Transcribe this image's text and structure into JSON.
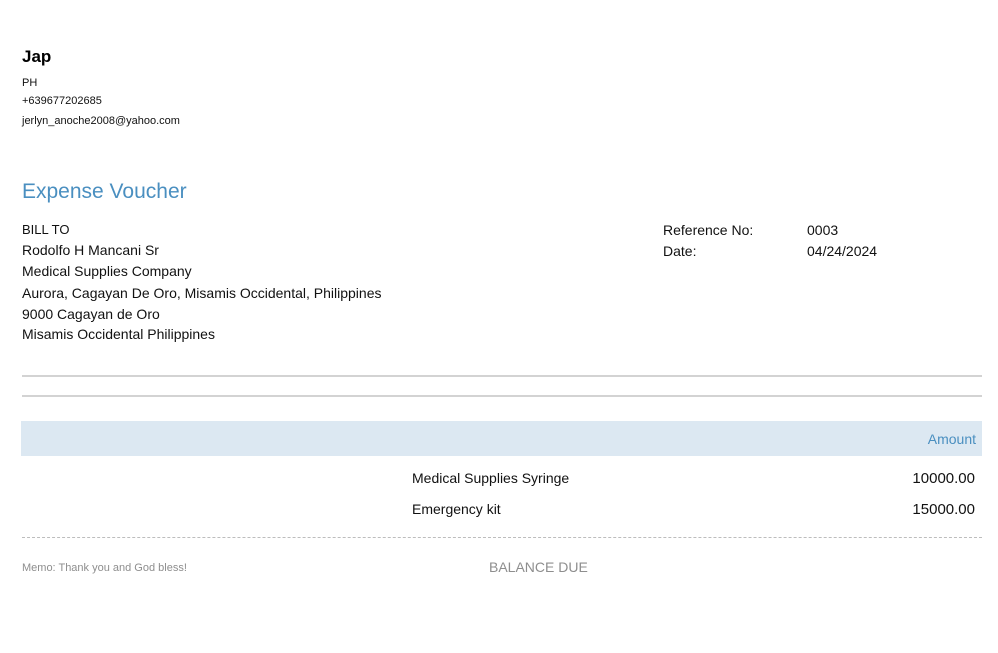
{
  "company": {
    "name": "Jap",
    "country": "PH",
    "phone": "+639677202685",
    "email": "jerlyn_anoche2008@yahoo.com"
  },
  "voucher": {
    "title": "Expense Voucher"
  },
  "bill_to": {
    "label": "BILL TO",
    "lines": [
      "Rodolfo H Mancani Sr",
      "Medical Supplies Company",
      "Aurora, Cagayan De Oro, Misamis Occidental, Philippines",
      "9000 Cagayan de Oro",
      "Misamis Occidental Philippines"
    ]
  },
  "meta": {
    "reference_label": "Reference No:",
    "reference_value": "0003",
    "date_label": "Date:",
    "date_value": "04/24/2024"
  },
  "table": {
    "amount_header": "Amount",
    "rows": [
      {
        "description": "Medical Supplies Syringe",
        "amount": "10000.00"
      },
      {
        "description": "Emergency kit",
        "amount": "15000.00"
      }
    ]
  },
  "footer": {
    "memo": "Memo: Thank you and God bless!",
    "balance_due_label": "BALANCE DUE"
  },
  "colors": {
    "accent": "#4a8fc0",
    "header_band": "#dce8f2",
    "muted_text": "#8e8e8e"
  }
}
